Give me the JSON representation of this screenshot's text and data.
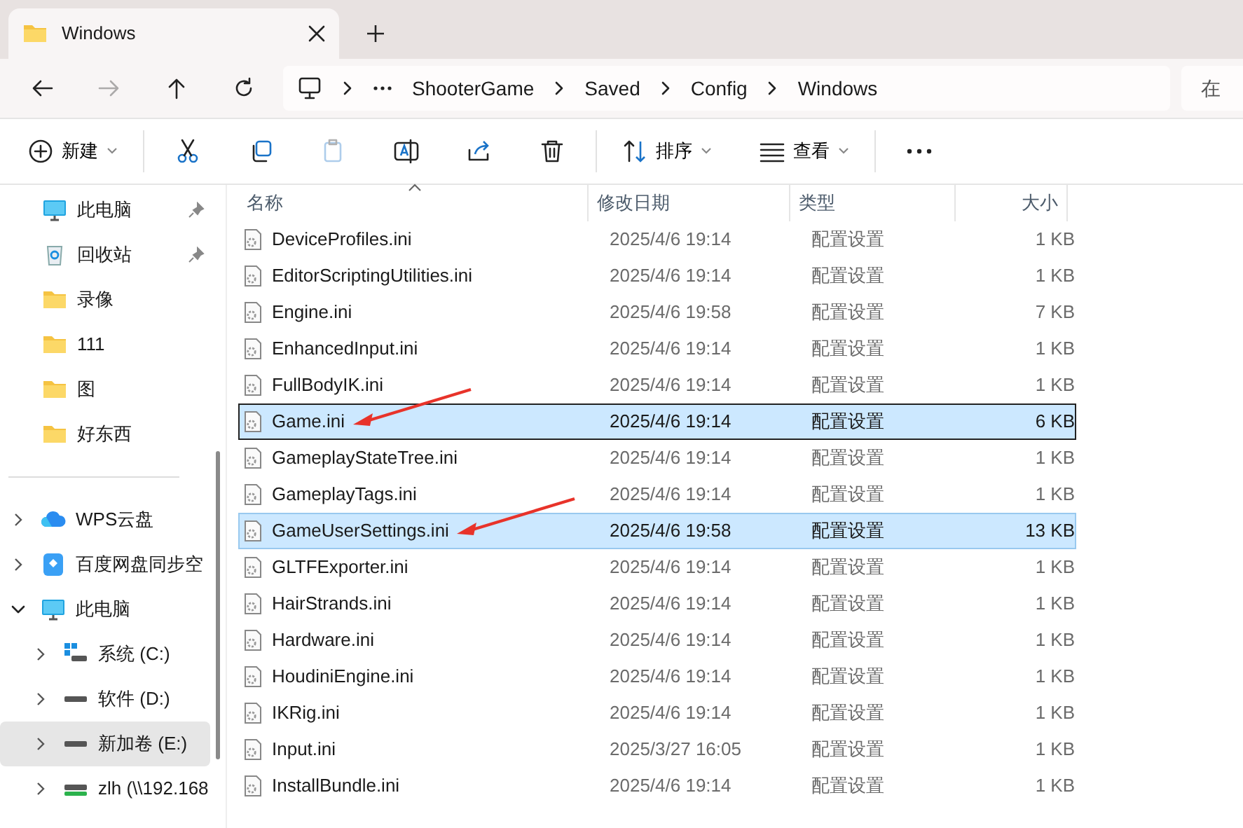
{
  "tabs": [
    {
      "label": "Windows",
      "selected": true
    }
  ],
  "nav_buttons": [
    {
      "kind": "back",
      "disabled": false
    },
    {
      "kind": "forward",
      "disabled": true
    },
    {
      "kind": "up",
      "disabled": false
    },
    {
      "kind": "refresh",
      "disabled": false
    }
  ],
  "breadcrumb": [
    "ShooterGame",
    "Saved",
    "Config",
    "Windows"
  ],
  "search": {
    "placeholder": "在"
  },
  "toolbar": [
    {
      "kind": "new",
      "label": "新建",
      "disabled": false
    },
    {
      "kind": "cut",
      "disabled": false
    },
    {
      "kind": "copy",
      "disabled": false
    },
    {
      "kind": "paste",
      "disabled": true
    },
    {
      "kind": "rename",
      "disabled": false
    },
    {
      "kind": "share",
      "disabled": false
    },
    {
      "kind": "delete",
      "disabled": false
    },
    {
      "kind": "sort",
      "label": "排序",
      "disabled": false
    },
    {
      "kind": "view",
      "label": "查看",
      "disabled": false
    },
    {
      "kind": "more",
      "disabled": false
    }
  ],
  "quick_access": [
    {
      "label": "此电脑",
      "kind": "pc",
      "pinned": true
    },
    {
      "label": "回收站",
      "kind": "recycle",
      "pinned": true
    },
    {
      "label": "录像",
      "kind": "folder",
      "pinned": false
    },
    {
      "label": "111",
      "kind": "folder",
      "pinned": false
    },
    {
      "label": "图",
      "kind": "folder",
      "pinned": false
    },
    {
      "label": "好东西",
      "kind": "folder",
      "pinned": false
    }
  ],
  "tree": [
    {
      "label": "WPS云盘",
      "kind": "cloud",
      "expanded": false,
      "selected": false
    },
    {
      "label": "百度网盘同步空",
      "kind": "baidu",
      "expanded": false,
      "selected": false
    },
    {
      "label": "此电脑",
      "kind": "pc",
      "expanded": true,
      "selected": false,
      "children": [
        {
          "label": "系统 (C:)",
          "kind": "system-drive",
          "expanded": false,
          "selected": false
        },
        {
          "label": "软件 (D:)",
          "kind": "drive",
          "expanded": false,
          "selected": false
        },
        {
          "label": "新加卷 (E:)",
          "kind": "drive",
          "expanded": false,
          "selected": true
        },
        {
          "label": "zlh (\\\\192.168",
          "kind": "network-drive",
          "expanded": false,
          "selected": false
        }
      ]
    }
  ],
  "table": {
    "columns": [
      {
        "label": "名称",
        "sorted": true
      },
      {
        "label": "修改日期",
        "sorted": false
      },
      {
        "label": "类型",
        "sorted": false
      },
      {
        "label": "大小",
        "sorted": false
      }
    ],
    "rows": [
      {
        "name": "DeviceProfiles.ini",
        "date": "2025/4/6 19:14",
        "type": "配置设置",
        "size": "1 KB",
        "selected": false,
        "focused": false,
        "arrow": false
      },
      {
        "name": "EditorScriptingUtilities.ini",
        "date": "2025/4/6 19:14",
        "type": "配置设置",
        "size": "1 KB",
        "selected": false,
        "focused": false,
        "arrow": false
      },
      {
        "name": "Engine.ini",
        "date": "2025/4/6 19:58",
        "type": "配置设置",
        "size": "7 KB",
        "selected": false,
        "focused": false,
        "arrow": false
      },
      {
        "name": "EnhancedInput.ini",
        "date": "2025/4/6 19:14",
        "type": "配置设置",
        "size": "1 KB",
        "selected": false,
        "focused": false,
        "arrow": false
      },
      {
        "name": "FullBodyIK.ini",
        "date": "2025/4/6 19:14",
        "type": "配置设置",
        "size": "1 KB",
        "selected": false,
        "focused": false,
        "arrow": false
      },
      {
        "name": "Game.ini",
        "date": "2025/4/6 19:14",
        "type": "配置设置",
        "size": "6 KB",
        "selected": true,
        "focused": true,
        "arrow": true
      },
      {
        "name": "GameplayStateTree.ini",
        "date": "2025/4/6 19:14",
        "type": "配置设置",
        "size": "1 KB",
        "selected": false,
        "focused": false,
        "arrow": false
      },
      {
        "name": "GameplayTags.ini",
        "date": "2025/4/6 19:14",
        "type": "配置设置",
        "size": "1 KB",
        "selected": false,
        "focused": false,
        "arrow": false
      },
      {
        "name": "GameUserSettings.ini",
        "date": "2025/4/6 19:58",
        "type": "配置设置",
        "size": "13 KB",
        "selected": true,
        "focused": false,
        "arrow": true
      },
      {
        "name": "GLTFExporter.ini",
        "date": "2025/4/6 19:14",
        "type": "配置设置",
        "size": "1 KB",
        "selected": false,
        "focused": false,
        "arrow": false
      },
      {
        "name": "HairStrands.ini",
        "date": "2025/4/6 19:14",
        "type": "配置设置",
        "size": "1 KB",
        "selected": false,
        "focused": false,
        "arrow": false
      },
      {
        "name": "Hardware.ini",
        "date": "2025/4/6 19:14",
        "type": "配置设置",
        "size": "1 KB",
        "selected": false,
        "focused": false,
        "arrow": false
      },
      {
        "name": "HoudiniEngine.ini",
        "date": "2025/4/6 19:14",
        "type": "配置设置",
        "size": "1 KB",
        "selected": false,
        "focused": false,
        "arrow": false
      },
      {
        "name": "IKRig.ini",
        "date": "2025/4/6 19:14",
        "type": "配置设置",
        "size": "1 KB",
        "selected": false,
        "focused": false,
        "arrow": false
      },
      {
        "name": "Input.ini",
        "date": "2025/3/27 16:05",
        "type": "配置设置",
        "size": "1 KB",
        "selected": false,
        "focused": false,
        "arrow": false
      },
      {
        "name": "InstallBundle.ini",
        "date": "2025/4/6 19:14",
        "type": "配置设置",
        "size": "1 KB",
        "selected": false,
        "focused": false,
        "arrow": false
      }
    ]
  }
}
